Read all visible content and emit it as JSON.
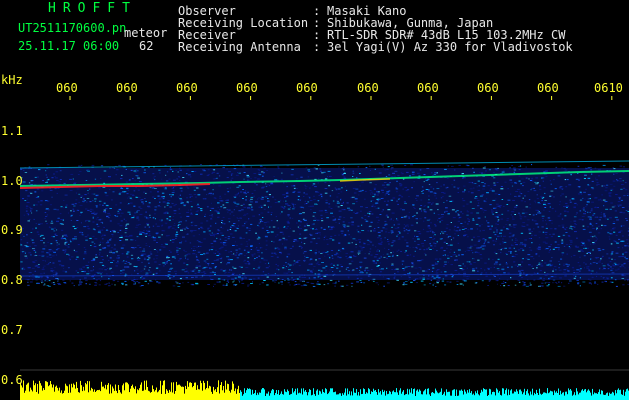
{
  "header": {
    "title": "HROFFT",
    "filename": "UT2511170600.pn",
    "mode": "meteor",
    "datetime": "25.11.17 06:00",
    "count": "62",
    "info": [
      {
        "label": "Observer",
        "value": "Masaki Kano"
      },
      {
        "label": "Receiving Location",
        "value": "Shibukawa, Gunma, Japan"
      },
      {
        "label": "Receiver",
        "value": "RTL-SDR SDR# 43dB L15 103.2MHz CW"
      },
      {
        "label": "Receiving Antenna",
        "value": "3el Yagi(V) Az 330 for Vladivostok"
      }
    ]
  },
  "axis": {
    "unit": "kHz",
    "y_ticks": [
      "1.1",
      "1.0",
      "0.9",
      "0.8",
      "0.7",
      "0.6"
    ],
    "x_ticks": [
      "060",
      "060",
      "060",
      "060",
      "060",
      "060",
      "060",
      "060",
      "060",
      "0610"
    ]
  },
  "colors": {
    "background": "#000000",
    "header_title": "#00ff40",
    "axis_text": "#ffff30",
    "info_text": "#e8e8e8",
    "signal_low": "#0a1a8c",
    "signal_mid": "#00c8ff",
    "signal_high": "#ff2020",
    "bottom_bar_yellow": "#ffff00",
    "bottom_bar_cyan": "#00ffff"
  }
}
